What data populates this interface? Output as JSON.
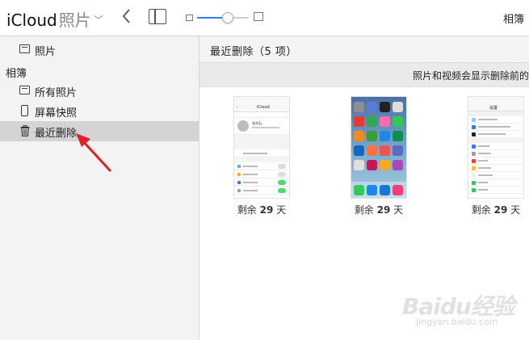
{
  "header": {
    "brand": "iCloud",
    "section": "照片",
    "albums_link": "相簿",
    "zoom_level": 0.6
  },
  "sidebar": {
    "items_top": [
      {
        "label": "照片",
        "icon": "photos-icon"
      }
    ],
    "heading": "相簿",
    "items": [
      {
        "label": "所有照片",
        "icon": "photos-icon"
      },
      {
        "label": "屏幕快照",
        "icon": "phone-icon"
      },
      {
        "label": "最近删除",
        "icon": "trash-icon",
        "selected": true
      }
    ]
  },
  "main": {
    "title": "最近删除（5 项）",
    "notice": "照片和视频会显示删除前的",
    "thumbnails": [
      {
        "caption_prefix": "剩余",
        "days": "29",
        "caption_suffix": "天",
        "name": "iCloud",
        "user": "张东石"
      },
      {
        "caption_prefix": "剩余",
        "days": "29",
        "caption_suffix": "天"
      },
      {
        "caption_prefix": "剩余",
        "days": "29",
        "caption_suffix": "天",
        "name": "设置",
        "items": [
          "iCloud",
          "iTunes Store 与 App Store",
          "Wallet 与 Apple Pay",
          "邮件",
          "通讯录",
          "日历",
          "备忘录",
          "提醒事项",
          "电话",
          "信息"
        ]
      }
    ]
  },
  "watermark": {
    "main": "Baidu经验",
    "sub": "jingyan.baidu.com"
  },
  "colors": {
    "accent": "#2d7cf6",
    "annotation": "#e31e24",
    "selected_bg": "#d4d4d4"
  }
}
